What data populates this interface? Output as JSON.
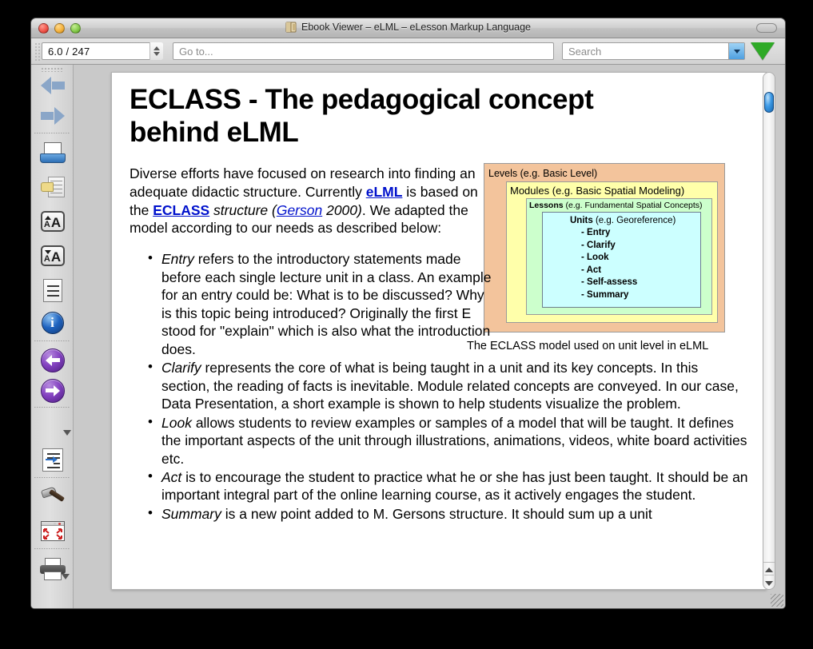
{
  "window": {
    "title": "Ebook Viewer – eLML – eLesson Markup Language",
    "title_icon": "book-icon",
    "traffic_lights": {
      "close": "close-button",
      "minimize": "minimize-button",
      "zoom": "zoom-button"
    },
    "toolbar_toggle": "toolbar-toggle-button"
  },
  "toolbar": {
    "page_value": "6.0 / 247",
    "goto_placeholder": "Go to...",
    "goto_value": "",
    "search_placeholder": "Search",
    "search_value": "",
    "search_dropdown_icon": "chevron-down-icon",
    "search_next_icon": "green-down-triangle-icon"
  },
  "sidebar": {
    "items": [
      {
        "name": "previous-page",
        "icon": "left-arrow-icon"
      },
      {
        "name": "next-page",
        "icon": "right-arrow-icon"
      },
      {
        "name": "open-book",
        "icon": "open-book-icon"
      },
      {
        "name": "copy-to-library",
        "icon": "copy-icon"
      },
      {
        "name": "increase-font-size",
        "icon": "font-increase-icon",
        "small": "A",
        "large": "A"
      },
      {
        "name": "decrease-font-size",
        "icon": "font-decrease-icon",
        "small": "A",
        "large": "A"
      },
      {
        "name": "table-of-contents",
        "icon": "document-lines-icon"
      },
      {
        "name": "book-info",
        "icon": "info-icon",
        "glyph": "i"
      },
      {
        "name": "back",
        "icon": "circle-back-arrow-icon"
      },
      {
        "name": "forward",
        "icon": "circle-forward-arrow-icon"
      },
      {
        "name": "bookmarks",
        "icon": "star-icon",
        "has_menu": true
      },
      {
        "name": "reference-mode",
        "icon": "reference-icon"
      },
      {
        "name": "preferences",
        "icon": "hammer-icon"
      },
      {
        "name": "full-screen",
        "icon": "fullscreen-icon"
      },
      {
        "name": "print",
        "icon": "printer-icon",
        "has_menu": true
      }
    ]
  },
  "document": {
    "title": "ECLASS - The pedagogical concept behind eLML",
    "intro": {
      "seg1": "Diverse efforts have focused on research into finding an adequate didactic structure. Currently ",
      "link_elml": "eLML",
      "seg2": " is based on the ",
      "link_eclass": "ECLASS",
      "seg3": " structure (",
      "link_gerson": "Gerson",
      "seg4": " 2000)",
      "seg5": ". We adapted the model according to our needs as described below:"
    },
    "bullets": [
      {
        "term": "Entry",
        "text": " refers to the introductory statements made before each single lecture unit in a class. An example for an entry could be: What is to be discussed? Why is this topic being introduced? Originally the first E stood for \"explain\" which is also what the introduction does.",
        "narrow": true
      },
      {
        "term": "Clarify",
        "text": " represents the core of what is being taught in a unit and its key concepts. In this section, the reading of facts is inevitable. Module related concepts are conveyed. In our case, Data Presentation, a short example is shown to help students visualize the problem.",
        "narrow": false
      },
      {
        "term": "Look",
        "text": " allows students to review examples or samples of a model that will be taught. It defines the important aspects of the unit through illustrations, animations, videos, white board activities etc.",
        "narrow": false
      },
      {
        "term": "Act",
        "text": " is to encourage the student to practice what he or she has just been taught. It should be an important integral part of the online learning course, as it actively engages the student.",
        "narrow": false
      },
      {
        "term": "Summary",
        "text": " is a new point added to M. Gersons structure. It should sum up a unit",
        "narrow": false
      }
    ],
    "figure": {
      "levels_label": "Levels (e.g. Basic Level)",
      "modules_label": "Modules (e.g. Basic Spatial Modeling)",
      "lessons_bold": "Lessons",
      "lessons_light": " (e.g. Fundamental Spatial Concepts)",
      "units_bold": "Units",
      "units_light": " (e.g. Georeference)",
      "unit_items": [
        "- Entry",
        "- Clarify",
        "- Look",
        "- Act",
        "- Self-assess",
        "- Summary"
      ],
      "caption": "The ECLASS model used on unit level in eLML",
      "colors": {
        "levels": "#f3c49c",
        "modules": "#ffffaa",
        "lessons": "#ccffcc",
        "units": "#ccffff"
      }
    }
  },
  "scrollbar": {
    "thumb": "vertical-scroll-thumb",
    "up_arrow": "scroll-up-arrow-icon",
    "down_arrow": "scroll-down-arrow-icon"
  },
  "colors": {
    "link": "#0011cc",
    "accent_green": "#2faa27",
    "accent_blue": "#3d9ae6"
  }
}
